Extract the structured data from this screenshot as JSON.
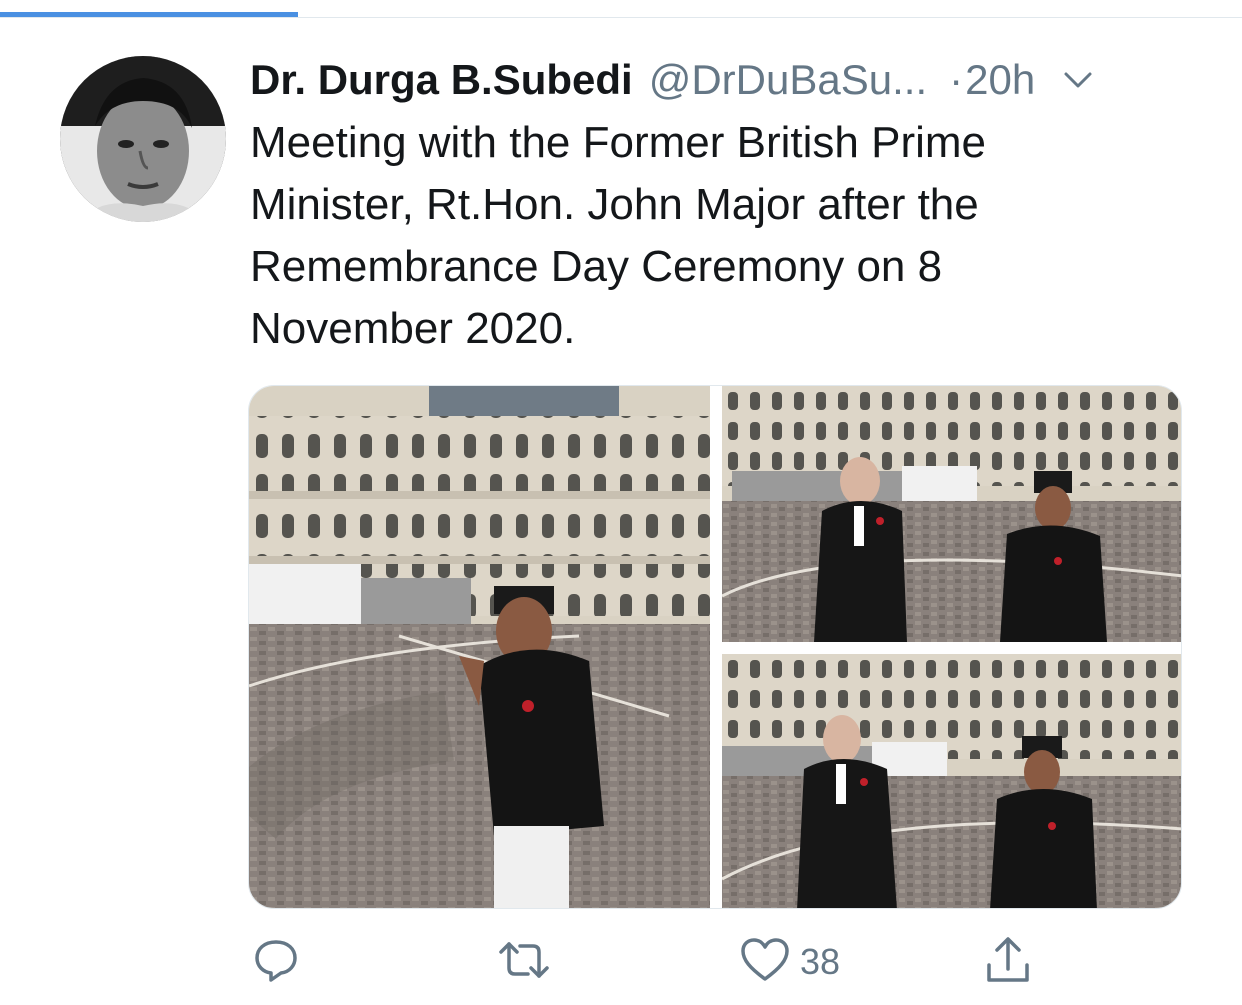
{
  "header": {
    "progress_fraction": 0.24
  },
  "tweet": {
    "author_name": "Dr. Durga B.Subedi",
    "author_handle": "@DrDuBaSu...",
    "separator": "·",
    "timestamp": "20h",
    "text": "Meeting with the Former British Prime Minister, Rt.Hon. John Major after the Remembrance Day Ceremony on 8 November 2020.",
    "media": {
      "photos": [
        {
          "icon": "photo-greeting-courtyard"
        },
        {
          "icon": "photo-two-men-courtyard"
        },
        {
          "icon": "photo-two-men-courtyard-alt"
        }
      ]
    },
    "actions": {
      "reply": {
        "icon": "reply-icon",
        "count": ""
      },
      "retweet": {
        "icon": "retweet-icon",
        "count": ""
      },
      "like": {
        "icon": "heart-icon",
        "count": "38"
      },
      "share": {
        "icon": "share-icon",
        "count": ""
      }
    }
  },
  "colors": {
    "text_primary": "#14171a",
    "text_secondary": "#657786",
    "accent": "#4a90e2",
    "divider": "#e1e8ed"
  }
}
